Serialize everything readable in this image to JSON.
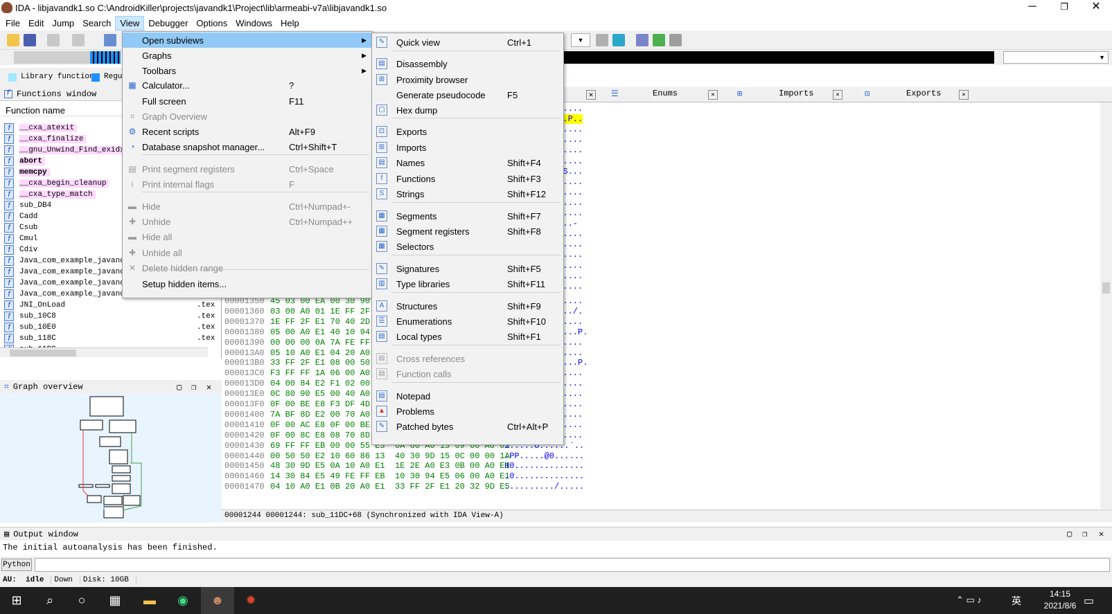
{
  "window": {
    "title": "IDA - libjavandk1.so C:\\AndroidKiller\\projects\\javandk1\\Project\\lib\\armeabi-v7a\\libjavandk1.so",
    "minimize": "─",
    "maximize": "❐",
    "close": "✕"
  },
  "menubar": [
    "File",
    "Edit",
    "Jump",
    "Search",
    "View",
    "Debugger",
    "Options",
    "Windows",
    "Help"
  ],
  "legend": {
    "library_function": "Library function",
    "regular": "Regu"
  },
  "functions_window": {
    "title": "Functions window",
    "header": "Function name",
    "rows": [
      {
        "name": "__cxa_atexit",
        "seg": ""
      },
      {
        "name": "__cxa_finalize",
        "seg": ""
      },
      {
        "name": "__gnu_Unwind_Find_exidx",
        "seg": ""
      },
      {
        "name": "abort",
        "seg": ""
      },
      {
        "name": "memcpy",
        "seg": ""
      },
      {
        "name": "__cxa_begin_cleanup",
        "seg": ""
      },
      {
        "name": "__cxa_type_match",
        "seg": ""
      },
      {
        "name": "sub_DB4",
        "seg": ""
      },
      {
        "name": "Cadd",
        "seg": ""
      },
      {
        "name": "Csub",
        "seg": ""
      },
      {
        "name": "Cmul",
        "seg": ""
      },
      {
        "name": "Cdiv",
        "seg": ""
      },
      {
        "name": "Java_com_example_javandk",
        "seg": ""
      },
      {
        "name": "Java_com_example_javandk",
        "seg": ""
      },
      {
        "name": "Java_com_example_javandk",
        "seg": ""
      },
      {
        "name": "Java_com_example_javandk",
        "seg": ""
      },
      {
        "name": "JNI_OnLoad",
        "seg": ".tex"
      },
      {
        "name": "sub_10C8",
        "seg": ".tex"
      },
      {
        "name": "sub_10E0",
        "seg": ".tex"
      },
      {
        "name": "sub_118C",
        "seg": ".tex"
      },
      {
        "name": "sub_11DC",
        "seg": ""
      }
    ]
  },
  "graph_overview": {
    "title": "Graph overview"
  },
  "tabs": [
    {
      "label": "Enums"
    },
    {
      "label": "Imports"
    },
    {
      "label": "Exports"
    }
  ],
  "hex": {
    "ascii_top": [
      "c.....",
      "...P..",
      "......",
      "......",
      "S.....",
      "......",
      "..S...",
      "......",
      "......",
      "......",
      "......",
      "....-",
      "......",
      "......",
      "......",
      "......",
      "......",
      "......"
    ],
    "lines": [
      {
        "addr": "00001350",
        "bytes": "45 03 00 EA 00 30 90",
        "ascii": "S....."
      },
      {
        "addr": "00001360",
        "bytes": "03 00 A0 01 1E FF 2F",
        "ascii": "..../."
      },
      {
        "addr": "00001370",
        "bytes": "1E FF 2F E1 70 40 2D",
        "ascii": "......"
      },
      {
        "addr": "00001380",
        "bytes": "05 00 A0 E1 40 10 94",
        "ascii": ".....P."
      },
      {
        "addr": "00001390",
        "bytes": "00 00 00 0A 7A FE FF",
        "ascii": "......"
      },
      {
        "addr": "000013A0",
        "bytes": "05 10 A0 E1 04 20 A0",
        "ascii": "......"
      },
      {
        "addr": "000013B0",
        "bytes": "33 FF 2F E1 08 00 50",
        "ascii": ".....P."
      },
      {
        "addr": "000013C0",
        "bytes": "F3 FF FF 1A 06 00 A0",
        "ascii": "......"
      },
      {
        "addr": "000013D0",
        "bytes": "04 00 84 E2 F1 02 00",
        "ascii": "-....."
      },
      {
        "addr": "000013E0",
        "bytes": "0C 80 90 E5 00 40 A0",
        "ascii": "......"
      },
      {
        "addr": "000013F0",
        "bytes": "0F 00 BE E8 F3 DF 4D",
        "ascii": "......"
      },
      {
        "addr": "00001400",
        "bytes": "7A BF 8D E2 00 70 A0",
        "ascii": "......"
      },
      {
        "addr": "00001410",
        "bytes": "0F 00 AC E8 0F 00 BE",
        "ascii": "......"
      },
      {
        "addr": "00001420",
        "bytes": "0F 00 8C E8 08 70 8D",
        "ascii": "......"
      },
      {
        "addr": "00001430",
        "bytes": "69 FF FF EB 00 00 55 E3  0A 60 A0 13 09 60 A0 03",
        "ascii": "i.....U......`.."
      },
      {
        "addr": "00001440",
        "bytes": "00 50 50 E2 10 60 86 13  40 30 9D 15 0C 00 00 1A",
        "ascii": ".PP.....@0......"
      },
      {
        "addr": "00001450",
        "bytes": "48 30 9D E5 0A 10 A0 E1  1E 2E A0 E3 0B 00 A0 E1",
        "ascii": "H0.............."
      },
      {
        "addr": "00001460",
        "bytes": "14 30 84 E5 49 FE FF EB  10 30 94 E5 06 00 A0 E1",
        "ascii": ".0.............."
      },
      {
        "addr": "00001470",
        "bytes": "04 10 A0 E1 0B 20 A0 E1  33 FF 2F E1 20 32 9D E5",
        "ascii": "........../....."
      }
    ],
    "status": "00001244 00001244: sub_11DC+68 (Synchronized with IDA View-A)"
  },
  "output": {
    "title": "Output window",
    "text": "The initial autoanalysis has been finished.",
    "python_label": "Python"
  },
  "statusbar": {
    "au": "AU:",
    "state": "idle",
    "dir": "Down",
    "disk": "Disk: 10GB"
  },
  "taskbar": {
    "time": "14:15",
    "date": "2021/8/6",
    "ime": "英"
  },
  "view_menu": [
    {
      "label": "Open subviews",
      "shortcut": "",
      "submenu": true,
      "highlighted": true,
      "disabled": false
    },
    {
      "label": "Graphs",
      "shortcut": "",
      "submenu": true,
      "disabled": false
    },
    {
      "label": "Toolbars",
      "shortcut": "",
      "submenu": true,
      "disabled": false
    },
    {
      "label": "Calculator...",
      "shortcut": "?",
      "disabled": false
    },
    {
      "label": "Full screen",
      "shortcut": "F11",
      "disabled": false
    },
    {
      "label": "Graph Overview",
      "shortcut": "",
      "disabled": true
    },
    {
      "label": "Recent scripts",
      "shortcut": "Alt+F9",
      "disabled": false
    },
    {
      "label": "Database snapshot manager...",
      "shortcut": "Ctrl+Shift+T",
      "disabled": false
    },
    {
      "label": "Print segment registers",
      "shortcut": "Ctrl+Space",
      "disabled": true
    },
    {
      "label": "Print internal flags",
      "shortcut": "F",
      "disabled": true
    },
    {
      "label": "Hide",
      "shortcut": "Ctrl+Numpad+-",
      "disabled": true
    },
    {
      "label": "Unhide",
      "shortcut": "Ctrl+Numpad++",
      "disabled": true
    },
    {
      "label": "Hide all",
      "shortcut": "",
      "disabled": true
    },
    {
      "label": "Unhide all",
      "shortcut": "",
      "disabled": true
    },
    {
      "label": "Delete hidden range",
      "shortcut": "",
      "disabled": true
    },
    {
      "label": "Setup hidden items...",
      "shortcut": "",
      "disabled": false
    }
  ],
  "subviews_menu": [
    {
      "label": "Quick view",
      "shortcut": "Ctrl+1",
      "disabled": false
    },
    {
      "label": "Disassembly",
      "shortcut": "",
      "disabled": false
    },
    {
      "label": "Proximity browser",
      "shortcut": "",
      "disabled": false
    },
    {
      "label": "Generate pseudocode",
      "shortcut": "F5",
      "disabled": false
    },
    {
      "label": "Hex dump",
      "shortcut": "",
      "disabled": false
    },
    {
      "label": "Exports",
      "shortcut": "",
      "disabled": false
    },
    {
      "label": "Imports",
      "shortcut": "",
      "disabled": false
    },
    {
      "label": "Names",
      "shortcut": "Shift+F4",
      "disabled": false
    },
    {
      "label": "Functions",
      "shortcut": "Shift+F3",
      "disabled": false
    },
    {
      "label": "Strings",
      "shortcut": "Shift+F12",
      "disabled": false
    },
    {
      "label": "Segments",
      "shortcut": "Shift+F7",
      "disabled": false
    },
    {
      "label": "Segment registers",
      "shortcut": "Shift+F8",
      "disabled": false
    },
    {
      "label": "Selectors",
      "shortcut": "",
      "disabled": false
    },
    {
      "label": "Signatures",
      "shortcut": "Shift+F5",
      "disabled": false
    },
    {
      "label": "Type libraries",
      "shortcut": "Shift+F11",
      "disabled": false
    },
    {
      "label": "Structures",
      "shortcut": "Shift+F9",
      "disabled": false
    },
    {
      "label": "Enumerations",
      "shortcut": "Shift+F10",
      "disabled": false
    },
    {
      "label": "Local types",
      "shortcut": "Shift+F1",
      "disabled": false
    },
    {
      "label": "Cross references",
      "shortcut": "",
      "disabled": true
    },
    {
      "label": "Function calls",
      "shortcut": "",
      "disabled": true
    },
    {
      "label": "Notepad",
      "shortcut": "",
      "disabled": false
    },
    {
      "label": "Problems",
      "shortcut": "",
      "disabled": false
    },
    {
      "label": "Patched bytes",
      "shortcut": "Ctrl+Alt+P",
      "disabled": false
    }
  ]
}
